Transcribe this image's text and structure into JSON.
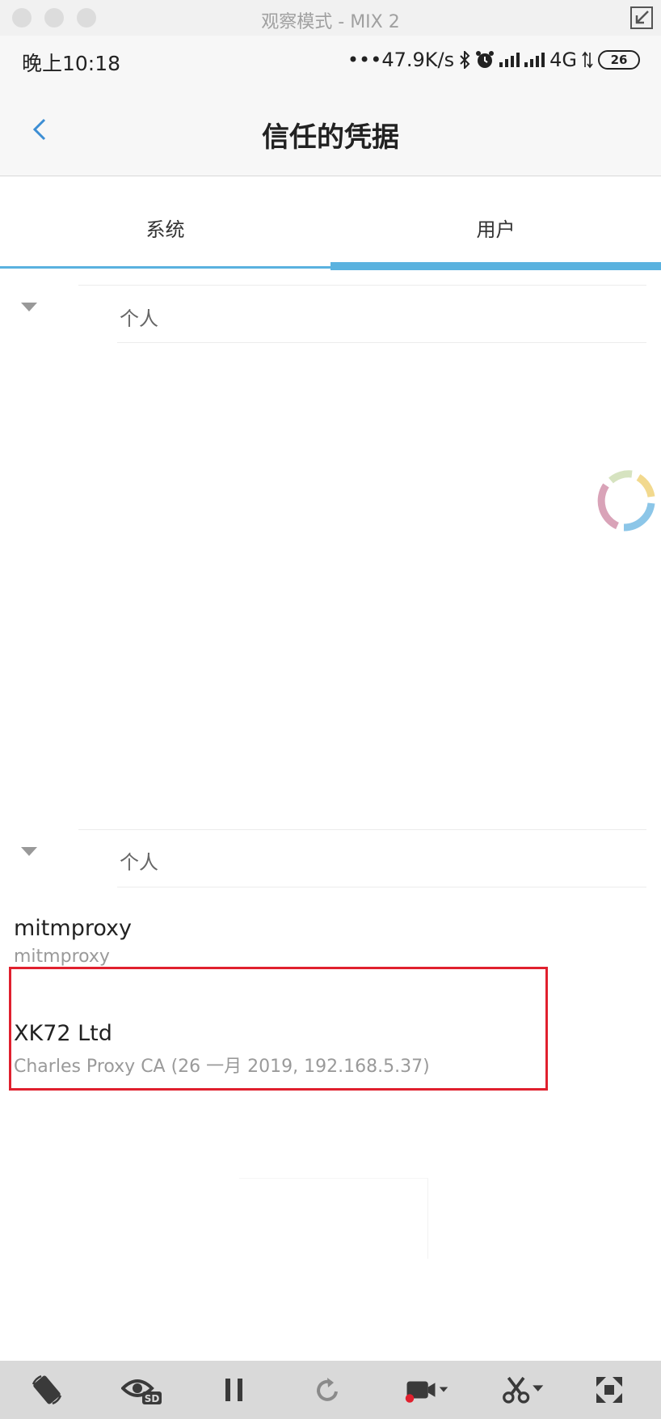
{
  "window": {
    "title": "观察模式 - MIX 2"
  },
  "status_bar": {
    "time": "晚上10:18",
    "network_speed": "•••47.9K/s",
    "network_type": "4G",
    "battery": "26"
  },
  "header": {
    "title": "信任的凭据"
  },
  "tabs": [
    {
      "label": "系统"
    },
    {
      "label": "用户",
      "selected": true
    }
  ],
  "sections": [
    {
      "label": "个人"
    },
    {
      "label": "个人"
    }
  ],
  "credentials": [
    {
      "title": "mitmproxy",
      "subtitle": "mitmproxy"
    },
    {
      "title": "XK72 Ltd",
      "subtitle": "Charles Proxy CA (26 一月 2019, 192.168.5.37)",
      "highlighted": true
    }
  ],
  "toolbar": {
    "icons": [
      "rotate-screen-icon",
      "eye-sd-icon",
      "pause-icon",
      "refresh-icon",
      "record-video-icon",
      "scissors-icon",
      "fullscreen-icon"
    ]
  },
  "colors": {
    "accent": "#5ab2df",
    "highlight": "#e0202e"
  }
}
